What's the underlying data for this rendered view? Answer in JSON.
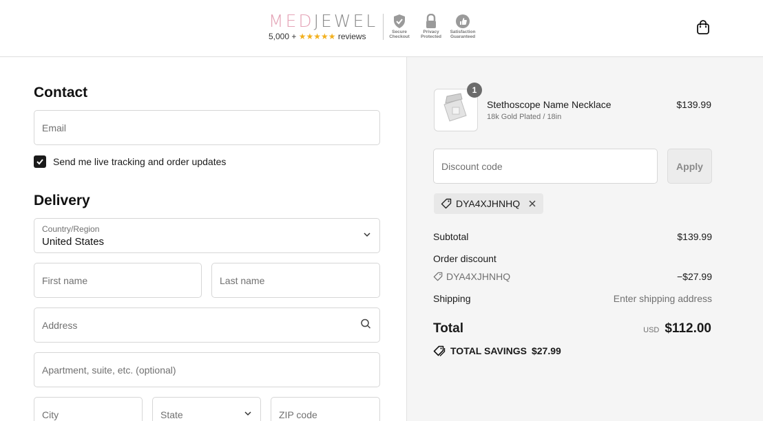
{
  "header": {
    "brand_part1": "MED",
    "brand_part2": "JEWEL",
    "reviews_count": "5,000 +",
    "stars": "★★★★★",
    "reviews_label": "reviews",
    "badges": [
      {
        "icon": "shield-check-icon",
        "label": "Secure Checkout"
      },
      {
        "icon": "lock-icon",
        "label": "Privacy Protected"
      },
      {
        "icon": "thumbs-up-icon",
        "label": "Satisfaction Guaranteed"
      }
    ],
    "cart_icon": "shopping-bag-icon"
  },
  "contact": {
    "heading": "Contact",
    "email_placeholder": "Email",
    "updates_checkbox": {
      "checked": true,
      "label": "Send me live tracking and order updates"
    }
  },
  "delivery": {
    "heading": "Delivery",
    "country_label": "Country/Region",
    "country_value": "United States",
    "first_name_placeholder": "First name",
    "last_name_placeholder": "Last name",
    "address_placeholder": "Address",
    "apartment_placeholder": "Apartment, suite, etc. (optional)",
    "city_placeholder": "City",
    "state_placeholder": "State",
    "zip_placeholder": "ZIP code"
  },
  "order_summary": {
    "item": {
      "quantity": "1",
      "name": "Stethoscope Name Necklace",
      "variant": "18k Gold Plated / 18in",
      "price": "$139.99"
    },
    "discount_placeholder": "Discount code",
    "apply_label": "Apply",
    "applied_code": "DYA4XJHNHQ",
    "subtotal_label": "Subtotal",
    "subtotal_value": "$139.99",
    "order_discount_label": "Order discount",
    "order_discount_code": "DYA4XJHNHQ",
    "order_discount_value": "−$27.99",
    "shipping_label": "Shipping",
    "shipping_value": "Enter shipping address",
    "total_label": "Total",
    "currency": "USD",
    "total_value": "$112.00",
    "savings_label": "TOTAL SAVINGS",
    "savings_value": "$27.99"
  },
  "colors": {
    "brand_pink": "#e4a3b6",
    "brand_gray": "#8b8b8b",
    "star_gold": "#f2b01e",
    "summary_bg": "#f5f5f5"
  }
}
